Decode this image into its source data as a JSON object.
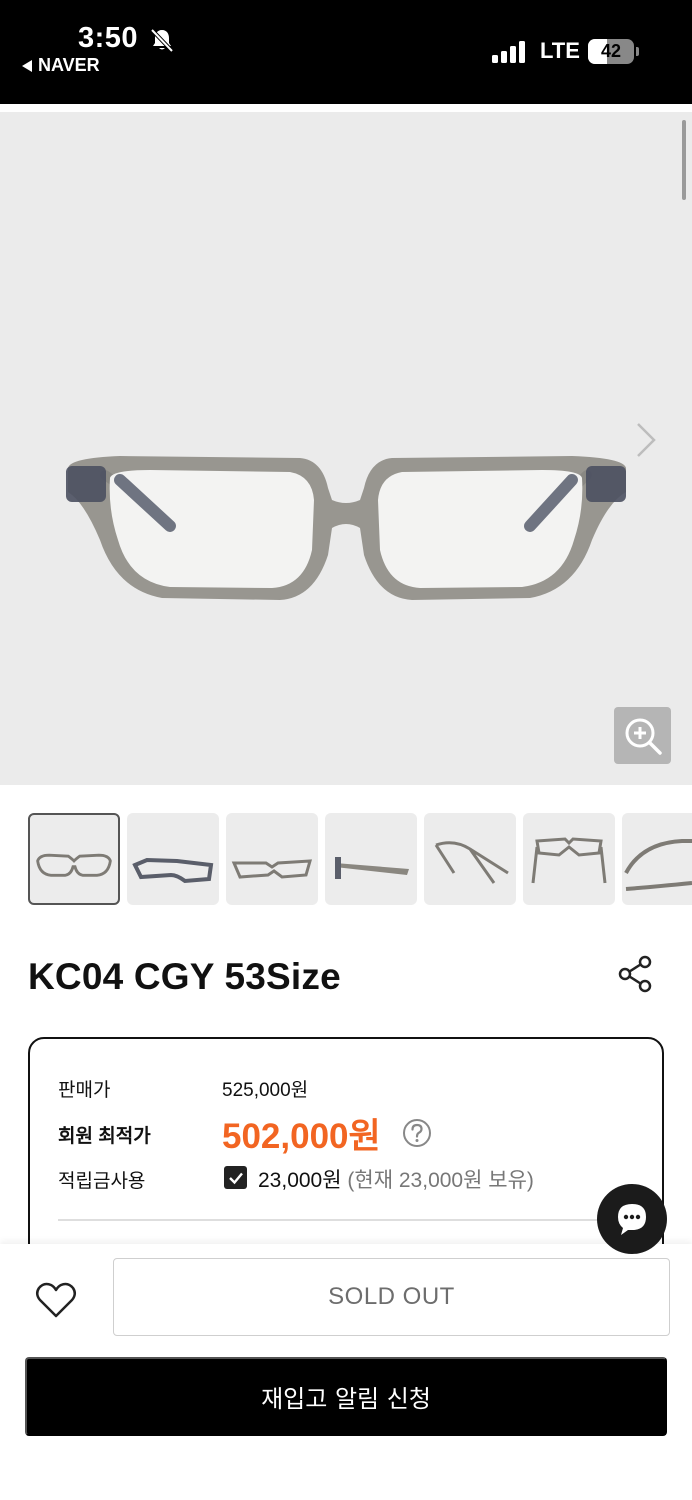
{
  "status_bar": {
    "time": "3:50",
    "back_app": "NAVER",
    "network": "LTE",
    "battery": "42",
    "battery_level": 0.42,
    "icons": [
      "bell-slash-icon",
      "signal-icon",
      "battery-icon"
    ]
  },
  "gallery": {
    "icons": [
      "next-arrow-icon",
      "zoom-in-icon"
    ],
    "thumbnails_count_visible": 7,
    "selected_index": 0
  },
  "product": {
    "title": "KC04 CGY 53Size"
  },
  "price": {
    "sale_label": "판매가",
    "sale_value": "525,000원",
    "member_label": "회원 최적가",
    "member_value": "502,000원",
    "points_label": "적립금사용",
    "points_value": "23,000원",
    "points_note": "(현재 23,000원 보유)",
    "accent_color": "#f26522"
  },
  "actions": {
    "sold_out": "SOLD OUT",
    "restock": "재입고 알림 신청"
  }
}
